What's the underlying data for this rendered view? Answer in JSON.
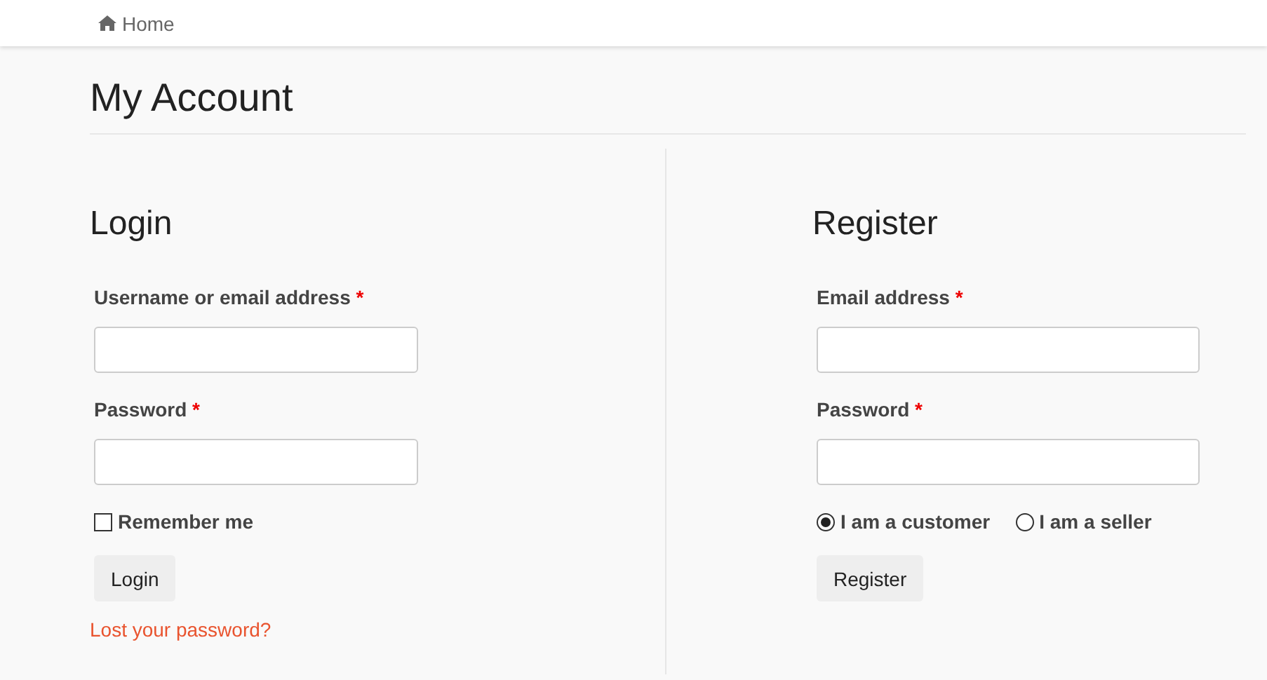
{
  "breadcrumb": {
    "label": "Home"
  },
  "title": "My Account",
  "login": {
    "heading": "Login",
    "fields": [
      {
        "label": "Username or email address",
        "required_mark": "*"
      },
      {
        "label": "Password",
        "required_mark": "*"
      }
    ],
    "remember": {
      "label": "Remember me",
      "checked": false
    },
    "button": "Login",
    "link": "Lost your password?"
  },
  "register": {
    "heading": "Register",
    "fields": [
      {
        "label": "Email address",
        "required_mark": "*"
      },
      {
        "label": "Password",
        "required_mark": "*"
      }
    ],
    "roles": [
      {
        "label": "I am a customer",
        "selected": true
      },
      {
        "label": "I am a seller",
        "selected": false
      }
    ],
    "button": "Register"
  }
}
